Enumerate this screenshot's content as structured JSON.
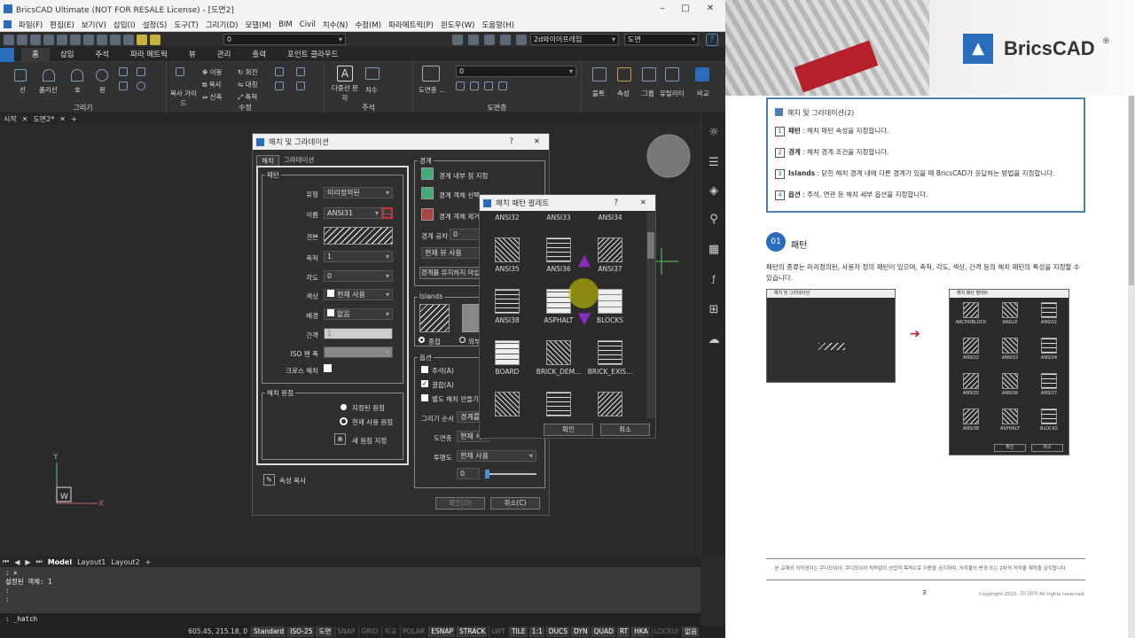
{
  "app": {
    "title": "BricsCAD Ultimate (NOT FOR RESALE License) - [도면2]",
    "menu": [
      "파일(F)",
      "편집(E)",
      "보기(V)",
      "삽입(I)",
      "설정(S)",
      "도구(T)",
      "그리기(D)",
      "모델(M)",
      "BIM",
      "Civil",
      "치수(N)",
      "수정(M)",
      "파라메트릭(P)",
      "윈도우(W)",
      "도움말(H)"
    ],
    "qat_layer": "0",
    "qat_visual_style": "2d와이어프레임",
    "qat_view": "도면",
    "ribbon_tabs": [
      "홈",
      "삽입",
      "주석",
      "파라 메트릭",
      "뷰",
      "관리",
      "출력",
      "포인트 클라우드"
    ],
    "ribbon_active_tab": "홈",
    "ribbon_labels": {
      "line": "선",
      "polyline": "폴리선",
      "arc": "호",
      "circle": "원",
      "draw_group": "그리기",
      "move": "이동",
      "rotate": "회전",
      "copy": "복사",
      "mirror": "대칭",
      "stretch": "신축",
      "scale": "축척",
      "copy_guide": "복사 가이드",
      "modify_group": "수정",
      "mtext": "다중선 문자",
      "dimension": "치수",
      "annotate_group": "주석",
      "layer_state": "도면층 ...",
      "layer_group": "도면층",
      "layer_value": "0",
      "block": "블록",
      "properties": "속성",
      "group": "그룹",
      "utilities": "유틸리티",
      "compare": "비교"
    },
    "doc_tabs": [
      "시작",
      "도면2*"
    ],
    "layout_tabs": [
      "Model",
      "Layout1",
      "Layout2"
    ],
    "command_lines": [
      ": ×",
      "설정된 객체: 1",
      ":",
      ":"
    ],
    "command_prompt": ": _hatch",
    "status": {
      "coords": "605.45, 215.18, 0",
      "items": [
        {
          "t": "Standard",
          "on": true
        },
        {
          "t": "ISO-25",
          "on": true
        },
        {
          "t": "도면",
          "on": true
        },
        {
          "t": "SNAP",
          "on": false
        },
        {
          "t": "GRID",
          "on": false
        },
        {
          "t": "직교",
          "on": false
        },
        {
          "t": "POLAR",
          "on": false
        },
        {
          "t": "ESNAP",
          "on": true
        },
        {
          "t": "STRACK",
          "on": true
        },
        {
          "t": "LWT",
          "on": false
        },
        {
          "t": "TILE",
          "on": true
        },
        {
          "t": "1:1",
          "on": true
        },
        {
          "t": "DUCS",
          "on": true
        },
        {
          "t": "DYN",
          "on": true
        },
        {
          "t": "QUAD",
          "on": true
        },
        {
          "t": "RT",
          "on": true
        },
        {
          "t": "HKA",
          "on": true
        },
        {
          "t": "LOCKUI",
          "on": false
        },
        {
          "t": "없음",
          "on": true
        }
      ]
    }
  },
  "hatch_dialog": {
    "title": "해치 및 그라데이션",
    "tabs": [
      "해치",
      "그라데이션"
    ],
    "pattern_group": "패턴",
    "type_label": "유형",
    "type_value": "미리정의된",
    "name_label": "이름",
    "name_value": "ANSI31",
    "swatch_label": "견본",
    "scale_label": "축척",
    "scale_value": "1",
    "angle_label": "각도",
    "angle_value": "0",
    "color_label": "색상",
    "color_value": "현재 사용",
    "bg_label": "배경",
    "bg_value": "없음",
    "spacing_label": "간격",
    "spacing_value": "1",
    "iso_label": "ISO 펜 폭",
    "cross_label": "크로스 해치",
    "origin_group": "해치 원점",
    "origin_specified": "지정된 원점",
    "origin_current": "현재 사용 원점",
    "origin_new": "새 원점 지정",
    "copy_props": "속성 복사",
    "boundary_group": "경계",
    "pick_inside": "경계 내부 점 지정",
    "select_objects": "경계 객체 선택",
    "remove_boundary": "경계 객체 제거",
    "gap_label": "경계 공차",
    "gap_value": "0",
    "current_view": "현재 뷰 사용",
    "keep_boundary": "경계를 유지하지 마십",
    "islands_group": "Islands",
    "island_nested": "중첩",
    "island_outer": "외부",
    "options_group": "옵션",
    "annotative": "주석(A)",
    "associative": "결합(A)",
    "separate": "별도 해치 만들기(",
    "draw_order_label": "그리기 순서",
    "draw_order_value": "경계를",
    "layer_label": "도면층",
    "layer_value": "현재 사",
    "transparency_label": "투명도",
    "transparency_value": "현재 사용",
    "transparency_num": "0",
    "ok": "확인(O)",
    "cancel": "취소(C)"
  },
  "palette": {
    "title": "해치 패턴 팔레트",
    "patterns": [
      [
        "ANSI32",
        "ANSI33",
        "ANSI34"
      ],
      [
        "ANSI35",
        "ANSI36",
        "ANSI37"
      ],
      [
        "ANSI38",
        "ASPHALT",
        "BLOCKS"
      ],
      [
        "BOARD",
        "BRICK_DEM...",
        "BRICK_EXIS..."
      ],
      [
        "",
        "",
        ""
      ]
    ],
    "ok": "확인",
    "cancel": "취소"
  },
  "doc": {
    "brand": "BricsCAD",
    "reg": "®",
    "box_title": "해치 및 그라데이션(2)",
    "box_items": [
      {
        "n": "1",
        "b": "패턴",
        "t": " : 해치 패턴 속성을 지정합니다."
      },
      {
        "n": "2",
        "b": "경계",
        "t": " : 해치 경계 조건을 지정합니다."
      },
      {
        "n": "3",
        "b": "Islands",
        "t": " : 닫힌 해치 경계 내에 다른 경계가 있을 때 BricsCAD가 응답하는 방법을 지정합니다."
      },
      {
        "n": "4",
        "b": "옵션",
        "t": " : 주석, 연관 등 해치 세부 옵션을 지정합니다."
      }
    ],
    "section_num": "01",
    "section_title": "패턴",
    "para1": "패턴의 종류는 미리정의된, 사용자 정의 패턴이 있으며, 축척, 각도, 색상, 간격 등의 해치 패턴의 특성을 지정할 수",
    "para2": "있습니다.",
    "fig_left_title": "해치 및 그라데이션",
    "fig_right_title": "해치 패턴 팔레트",
    "fig_right_items": [
      "ARCHOBLOCK",
      "ANGLE",
      "ANSI31",
      "ANSI32",
      "ANSI33",
      "ANSI34",
      "ANSI35",
      "ANSI36",
      "ANSI37",
      "ANSI38",
      "ASPHALT",
      "BLOCKS"
    ],
    "fig_ok": "확인",
    "fig_cancel": "취소",
    "footer_note": "· 본 교재의 저작권자는 쿠디모이아, 쿠디모이아 허락없이 상업적 목적으로 이용을 금지하며, 저작물의 변경 또는 2차적 저작물 제작을 금지합니다.",
    "page_number": "3",
    "copyright": "Copyright 2022. 쿠디모아 All rights reserved."
  },
  "colors": {
    "accent": "#2a6ebb",
    "bricscad_red": "#b5202a",
    "cursor": "#ccc700",
    "purple": "#8a2bbf"
  }
}
